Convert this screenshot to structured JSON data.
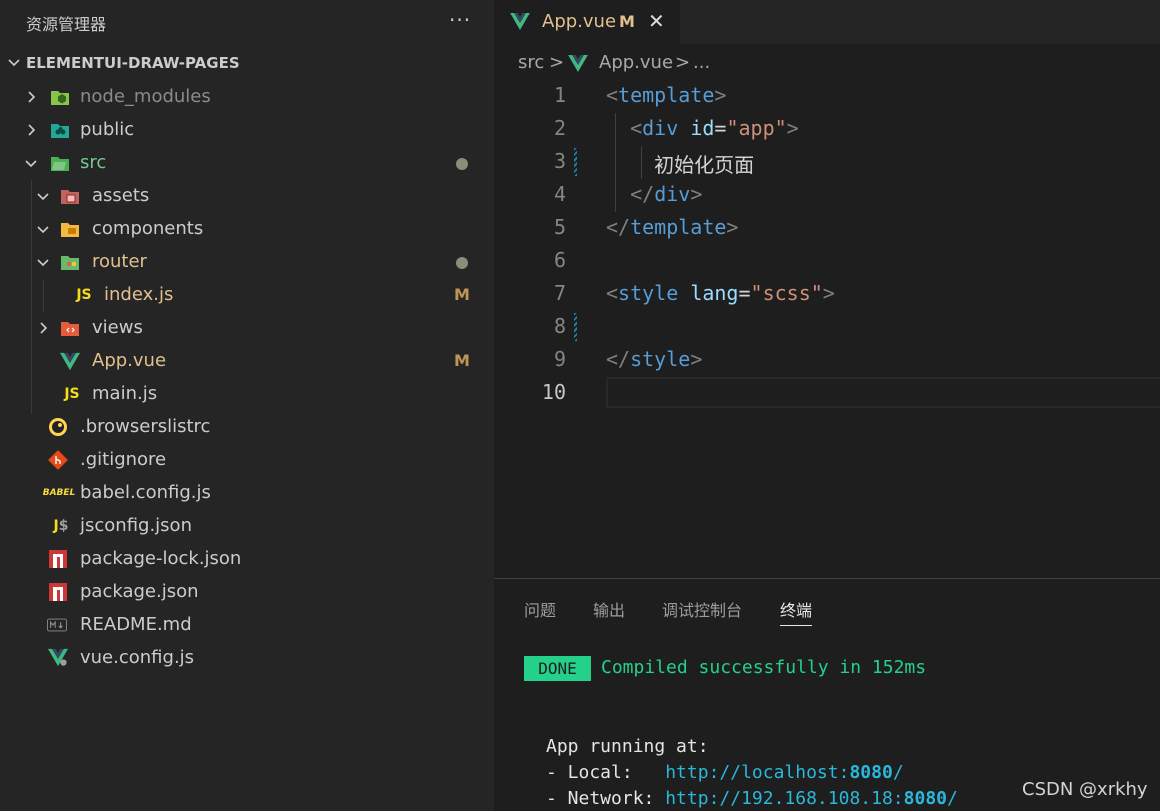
{
  "explorer": {
    "title": "资源管理器",
    "more": "···",
    "project": "ELEMENTUI-DRAW-PAGES",
    "items": [
      {
        "name": "node_modules",
        "badge": ""
      },
      {
        "name": "public",
        "badge": ""
      },
      {
        "name": "src",
        "badge": "●"
      },
      {
        "name": "assets",
        "badge": ""
      },
      {
        "name": "components",
        "badge": ""
      },
      {
        "name": "router",
        "badge": "●"
      },
      {
        "name": "index.js",
        "badge": "M"
      },
      {
        "name": "views",
        "badge": ""
      },
      {
        "name": "App.vue",
        "badge": "M"
      },
      {
        "name": "main.js",
        "badge": ""
      },
      {
        "name": ".browserslistrc",
        "badge": ""
      },
      {
        "name": ".gitignore",
        "badge": ""
      },
      {
        "name": "babel.config.js",
        "badge": ""
      },
      {
        "name": "jsconfig.json",
        "badge": ""
      },
      {
        "name": "package-lock.json",
        "badge": ""
      },
      {
        "name": "package.json",
        "badge": ""
      },
      {
        "name": "README.md",
        "badge": ""
      },
      {
        "name": "vue.config.js",
        "badge": ""
      }
    ]
  },
  "editor": {
    "tab": {
      "name": "App.vue",
      "status": "M",
      "close": "✕"
    },
    "breadcrumb": {
      "folder": "src",
      "sep": ">",
      "file": "App.vue",
      "more": "..."
    },
    "lines": [
      {
        "n": "1",
        "text": "<template>"
      },
      {
        "n": "2",
        "text": "  <div id=\"app\">"
      },
      {
        "n": "3",
        "text": "    初始化页面"
      },
      {
        "n": "4",
        "text": "  </div>"
      },
      {
        "n": "5",
        "text": "</template>"
      },
      {
        "n": "6",
        "text": ""
      },
      {
        "n": "7",
        "text": "<style lang=\"scss\">"
      },
      {
        "n": "8",
        "text": ""
      },
      {
        "n": "9",
        "text": "</style>"
      },
      {
        "n": "10",
        "text": ""
      }
    ]
  },
  "panel": {
    "tabs": [
      "问题",
      "输出",
      "调试控制台",
      "终端"
    ],
    "active_tab": "终端",
    "terminal": {
      "badge": "DONE",
      "status": "Compiled successfully in 152ms",
      "running": "App running at:",
      "local_label": "- Local:   ",
      "local_url_a": "http://localhost:",
      "local_url_port": "8080",
      "local_url_b": "/",
      "network_label": "- Network: ",
      "network_url_a": "http://192.168.108.18:",
      "network_url_port": "8080",
      "network_url_b": "/"
    }
  },
  "watermark": "CSDN @xrkhy",
  "colors": {
    "sidebar_bg": "#252526",
    "editor_bg": "#1e1e1e",
    "modified": "#e2c08d",
    "vue_green": "#41b883",
    "terminal_green": "#23d18b",
    "link": "#29b8db"
  }
}
